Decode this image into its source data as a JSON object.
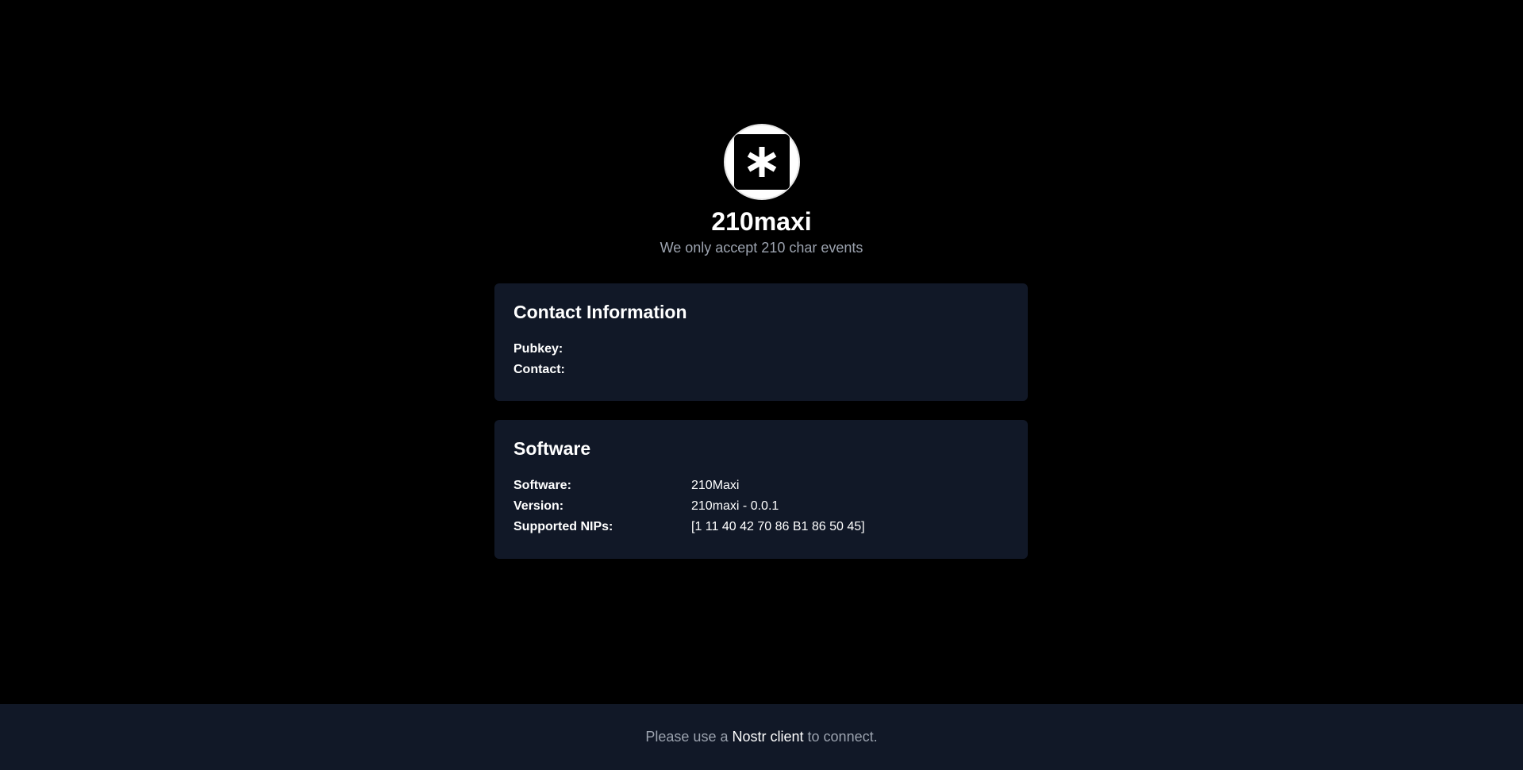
{
  "relay": {
    "avatar_icon": "asterisk-icon",
    "name": "210maxi",
    "description": "We only accept 210 char events"
  },
  "contact": {
    "heading": "Contact Information",
    "pubkey_label": "Pubkey:",
    "pubkey_value": "",
    "contact_label": "Contact:",
    "contact_value": ""
  },
  "software": {
    "heading": "Software",
    "rows": [
      {
        "label": "Software:",
        "value": "210Maxi"
      },
      {
        "label": "Version:",
        "value": "210maxi - 0.0.1"
      },
      {
        "label": "Supported NIPs:",
        "value": "[1 11 40 42 70 86 B1 86 50 45]"
      }
    ]
  },
  "footer": {
    "prefix": "Please use a",
    "link_text": "Nostr client",
    "suffix": "to connect."
  },
  "colors": {
    "background": "#000000",
    "card": "#111827",
    "muted_text": "#9ca3af"
  }
}
